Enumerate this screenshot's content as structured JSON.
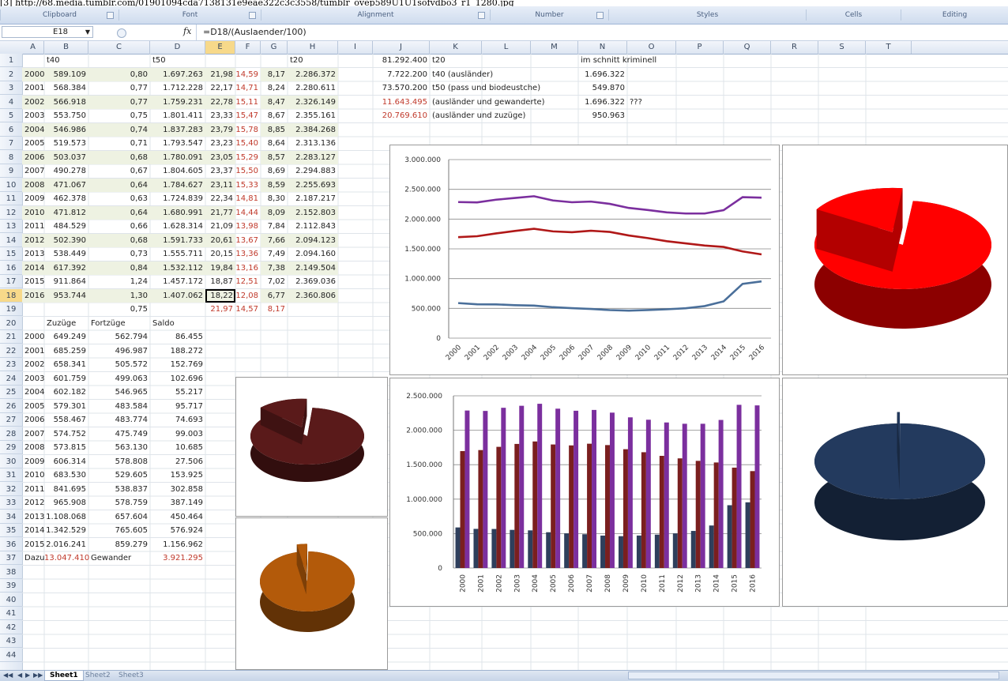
{
  "url_text": "[3] http://68.media.tumblr.com/01901094cda7138131e9eae322c3c3558/tumblr_ovep589U1U1sofvdbo3_r1_1280.jpg",
  "ribbon": {
    "groups": [
      "Clipboard",
      "Font",
      "Alignment",
      "Number",
      "Styles",
      "Cells",
      "Editing"
    ]
  },
  "formula_bar": {
    "name_box": "E18",
    "fx": "fx",
    "formula": "=D18/(Auslaender/100)"
  },
  "columns": [
    "A",
    "B",
    "C",
    "D",
    "E",
    "F",
    "G",
    "H",
    "I",
    "J",
    "K",
    "L",
    "M",
    "N",
    "O",
    "P",
    "Q",
    "R",
    "S",
    "T"
  ],
  "selected_column": "E",
  "selected_row": 18,
  "headers_row1": {
    "B": "t40",
    "D": "t50",
    "H": "t20"
  },
  "main_table": [
    [
      "2000",
      "589.109",
      "0,80",
      "1.697.263",
      "21,98",
      "14,59",
      "8,17",
      "2.286.372"
    ],
    [
      "2001",
      "568.384",
      "0,77",
      "1.712.228",
      "22,17",
      "14,71",
      "8,24",
      "2.280.611"
    ],
    [
      "2002",
      "566.918",
      "0,77",
      "1.759.231",
      "22,78",
      "15,11",
      "8,47",
      "2.326.149"
    ],
    [
      "2003",
      "553.750",
      "0,75",
      "1.801.411",
      "23,33",
      "15,47",
      "8,67",
      "2.355.161"
    ],
    [
      "2004",
      "546.986",
      "0,74",
      "1.837.283",
      "23,79",
      "15,78",
      "8,85",
      "2.384.268"
    ],
    [
      "2005",
      "519.573",
      "0,71",
      "1.793.547",
      "23,23",
      "15,40",
      "8,64",
      "2.313.136"
    ],
    [
      "2006",
      "503.037",
      "0,68",
      "1.780.091",
      "23,05",
      "15,29",
      "8,57",
      "2.283.127"
    ],
    [
      "2007",
      "490.278",
      "0,67",
      "1.804.605",
      "23,37",
      "15,50",
      "8,69",
      "2.294.883"
    ],
    [
      "2008",
      "471.067",
      "0,64",
      "1.784.627",
      "23,11",
      "15,33",
      "8,59",
      "2.255.693"
    ],
    [
      "2009",
      "462.378",
      "0,63",
      "1.724.839",
      "22,34",
      "14,81",
      "8,30",
      "2.187.217"
    ],
    [
      "2010",
      "471.812",
      "0,64",
      "1.680.991",
      "21,77",
      "14,44",
      "8,09",
      "2.152.803"
    ],
    [
      "2011",
      "484.529",
      "0,66",
      "1.628.314",
      "21,09",
      "13,98",
      "7,84",
      "2.112.843"
    ],
    [
      "2012",
      "502.390",
      "0,68",
      "1.591.733",
      "20,61",
      "13,67",
      "7,66",
      "2.094.123"
    ],
    [
      "2013",
      "538.449",
      "0,73",
      "1.555.711",
      "20,15",
      "13,36",
      "7,49",
      "2.094.160"
    ],
    [
      "2014",
      "617.392",
      "0,84",
      "1.532.112",
      "19,84",
      "13,16",
      "7,38",
      "2.149.504"
    ],
    [
      "2015",
      "911.864",
      "1,24",
      "1.457.172",
      "18,87",
      "12,51",
      "7,02",
      "2.369.036"
    ],
    [
      "2016",
      "953.744",
      "1,30",
      "1.407.062",
      "18,22",
      "12,08",
      "6,77",
      "2.360.806"
    ]
  ],
  "row19": {
    "C": "0,75",
    "E": "21,97",
    "F": "14,57",
    "G": "8,17"
  },
  "right_block": [
    {
      "J": "81.292.400",
      "K": "t20",
      "N": "im schnitt kriminell",
      "red": false
    },
    {
      "J": "7.722.200",
      "K": "t40 (ausländer)",
      "N": "1.696.322",
      "red": false
    },
    {
      "J": "73.570.200",
      "K": "t50 (pass und biodeustche)",
      "N": "549.870",
      "red": false
    },
    {
      "J": "11.643.495",
      "K": "(ausländer und gewanderte)",
      "N": "1.696.322",
      "O": "???",
      "red": true
    },
    {
      "J": "20.769.610",
      "K": "(ausländer und zuzüge)",
      "N": "950.963",
      "red": true
    }
  ],
  "migration_headers": {
    "B": "Zuzüge",
    "C": "Fortzüge",
    "D": "Saldo"
  },
  "migration_table": [
    [
      "2000",
      "649.249",
      "562.794",
      "86.455"
    ],
    [
      "2001",
      "685.259",
      "496.987",
      "188.272"
    ],
    [
      "2002",
      "658.341",
      "505.572",
      "152.769"
    ],
    [
      "2003",
      "601.759",
      "499.063",
      "102.696"
    ],
    [
      "2004",
      "602.182",
      "546.965",
      "55.217"
    ],
    [
      "2005",
      "579.301",
      "483.584",
      "95.717"
    ],
    [
      "2006",
      "558.467",
      "483.774",
      "74.693"
    ],
    [
      "2007",
      "574.752",
      "475.749",
      "99.003"
    ],
    [
      "2008",
      "573.815",
      "563.130",
      "10.685"
    ],
    [
      "2009",
      "606.314",
      "578.808",
      "27.506"
    ],
    [
      "2010",
      "683.530",
      "529.605",
      "153.925"
    ],
    [
      "2011",
      "841.695",
      "538.837",
      "302.858"
    ],
    [
      "2012",
      "965.908",
      "578.759",
      "387.149"
    ],
    [
      "2013",
      "1.108.068",
      "657.604",
      "450.464"
    ],
    [
      "2014",
      "1.342.529",
      "765.605",
      "576.924"
    ],
    [
      "2015",
      "2.016.241",
      "859.279",
      "1.156.962"
    ]
  ],
  "row37": {
    "A": "Dazu",
    "B": "13.047.410",
    "C": "Gewander",
    "D": "3.921.295"
  },
  "sheet_tabs": [
    "Sheet1",
    "Sheet2",
    "Sheet3"
  ],
  "colors": {
    "purple": "#7b2f9e",
    "darkred": "#b01818",
    "steel": "#4a6f9a",
    "navy": "#1d3557",
    "pie_red": "#ff0000",
    "pie_maroon": "#5a1a1a",
    "pie_orange": "#b35a0a",
    "pie_navy": "#233a5e"
  },
  "chart_data": [
    {
      "type": "line",
      "x": [
        "2000",
        "2001",
        "2002",
        "2003",
        "2004",
        "2005",
        "2006",
        "2007",
        "2008",
        "2009",
        "2010",
        "2011",
        "2012",
        "2013",
        "2014",
        "2015",
        "2016"
      ],
      "ylim": [
        0,
        3000000
      ],
      "yticks": [
        "0",
        "500.000",
        "1.000.000",
        "1.500.000",
        "2.000.000",
        "2.500.000",
        "3.000.000"
      ],
      "grid": true,
      "series": [
        {
          "color": "#7b2f9e",
          "values": [
            2286372,
            2280611,
            2326149,
            2355161,
            2384268,
            2313136,
            2283127,
            2294883,
            2255693,
            2187217,
            2152803,
            2112843,
            2094123,
            2094160,
            2149504,
            2369036,
            2360806
          ]
        },
        {
          "color": "#b01818",
          "values": [
            1697263,
            1712228,
            1759231,
            1801411,
            1837283,
            1793547,
            1780091,
            1804605,
            1784627,
            1724839,
            1680991,
            1628314,
            1591733,
            1555711,
            1532112,
            1457172,
            1407062
          ]
        },
        {
          "color": "#4a6f9a",
          "values": [
            589109,
            568384,
            566918,
            553750,
            546986,
            519573,
            503037,
            490278,
            471067,
            462378,
            471812,
            484529,
            502390,
            538449,
            617392,
            911864,
            953744
          ]
        }
      ]
    },
    {
      "type": "bar",
      "categories": [
        "2000",
        "2001",
        "2002",
        "2003",
        "2004",
        "2005",
        "2006",
        "2007",
        "2008",
        "2009",
        "2010",
        "2011",
        "2012",
        "2013",
        "2014",
        "2015",
        "2016"
      ],
      "ylim": [
        0,
        2500000
      ],
      "yticks": [
        "0",
        "500.000",
        "1.000.000",
        "1.500.000",
        "2.000.000",
        "2.500.000"
      ],
      "grid": true,
      "series": [
        {
          "color": "#2e3f5c",
          "values": [
            589109,
            568384,
            566918,
            553750,
            546986,
            519573,
            503037,
            490278,
            471067,
            462378,
            471812,
            484529,
            502390,
            538449,
            617392,
            911864,
            953744
          ]
        },
        {
          "color": "#7a1f1f",
          "values": [
            1697263,
            1712228,
            1759231,
            1801411,
            1837283,
            1793547,
            1780091,
            1804605,
            1784627,
            1724839,
            1680991,
            1628314,
            1591733,
            1555711,
            1532112,
            1457172,
            1407062
          ]
        },
        {
          "color": "#7b2f9e",
          "values": [
            2286372,
            2280611,
            2326149,
            2355161,
            2384268,
            2313136,
            2283127,
            2294883,
            2255693,
            2187217,
            2152803,
            2112843,
            2094123,
            2094160,
            2149504,
            2369036,
            2360806
          ]
        }
      ]
    },
    {
      "type": "pie",
      "color": "#ff0000",
      "values": [
        81.8,
        18.2
      ]
    },
    {
      "type": "pie",
      "color": "#5a1a1a",
      "values": [
        85.7,
        14.3
      ]
    },
    {
      "type": "pie",
      "color": "#b35a0a",
      "values": [
        96.5,
        3.5
      ]
    },
    {
      "type": "pie",
      "color": "#233a5e",
      "values": [
        99.5,
        0.5
      ]
    }
  ]
}
